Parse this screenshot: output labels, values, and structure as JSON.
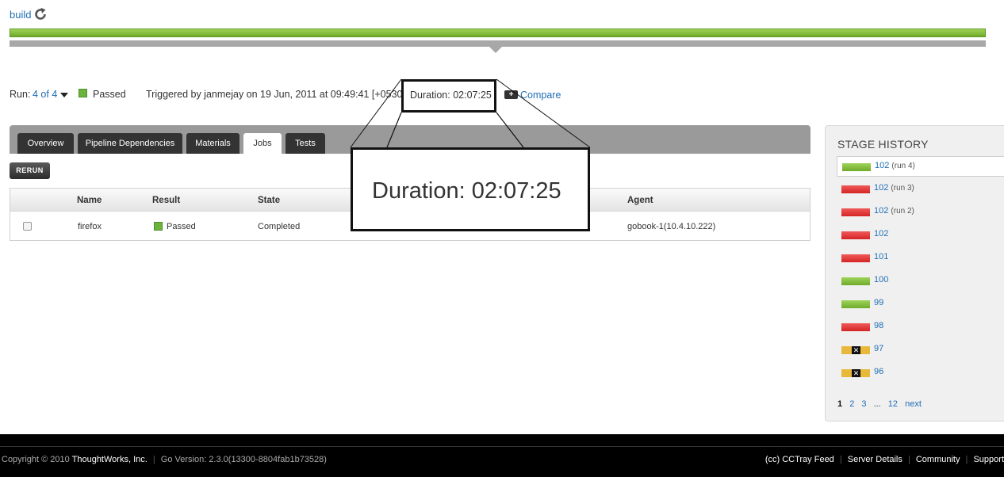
{
  "header": {
    "pipeline_link": "build",
    "refresh_icon": "refresh-icon",
    "progress_fraction": 1.0
  },
  "run_info": {
    "run_label": "Run:",
    "run_value": "4 of 4",
    "status": "Passed",
    "status_color": "#6cb33e",
    "triggered_text": "Triggered by janmejay on 19 Jun, 2011 at 09:49:41 [+0530]",
    "duration": "Duration: 02:07:25",
    "compare_label": "Compare"
  },
  "tabs": [
    {
      "label": "Overview",
      "active": false
    },
    {
      "label": "Pipeline Dependencies",
      "active": false
    },
    {
      "label": "Materials",
      "active": false
    },
    {
      "label": "Jobs",
      "active": true
    },
    {
      "label": "Tests",
      "active": false
    }
  ],
  "rerun_label": "RERUN",
  "jobs_table": {
    "columns": [
      "Name",
      "Result",
      "State",
      "Agent"
    ],
    "rows": [
      {
        "name": "firefox",
        "result": "Passed",
        "state": "Completed",
        "agent": "gobook-1(10.4.10.222)"
      }
    ]
  },
  "zoom_callout": {
    "text": "Duration: 02:07:25"
  },
  "stage_history": {
    "title": "STAGE HISTORY",
    "items": [
      {
        "label": "102",
        "run": "(run 4)",
        "status": "passed",
        "color": "#6fab2a"
      },
      {
        "label": "102",
        "run": "(run 3)",
        "status": "failed",
        "color": "#d42424"
      },
      {
        "label": "102",
        "run": "(run 2)",
        "status": "failed",
        "color": "#d42424"
      },
      {
        "label": "102",
        "run": "",
        "status": "failed",
        "color": "#d42424"
      },
      {
        "label": "101",
        "run": "",
        "status": "failed",
        "color": "#d42424"
      },
      {
        "label": "100",
        "run": "",
        "status": "passed",
        "color": "#6fab2a"
      },
      {
        "label": "99",
        "run": "",
        "status": "passed",
        "color": "#6fab2a"
      },
      {
        "label": "98",
        "run": "",
        "status": "failed",
        "color": "#d42424"
      },
      {
        "label": "97",
        "run": "",
        "status": "cancelled",
        "color": "#e8b83a"
      },
      {
        "label": "96",
        "run": "",
        "status": "cancelled",
        "color": "#e8b83a"
      }
    ],
    "pager": {
      "current": "1",
      "pages": [
        "2",
        "3"
      ],
      "ellipsis": "...",
      "last": "12",
      "next": "next"
    }
  },
  "footer": {
    "copyright": "Copyright © 2010",
    "company": "ThoughtWorks, Inc.",
    "version": "Go Version: 2.3.0(13300-8804fab1b73528)",
    "links": [
      "(cc) CCTray Feed",
      "Server Details",
      "Community",
      "Support"
    ]
  }
}
